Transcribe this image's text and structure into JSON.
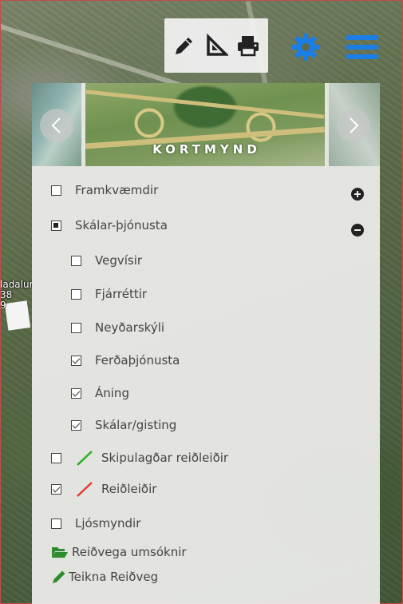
{
  "map": {
    "place_label_lines": [
      "ladalur",
      "38",
      "9"
    ]
  },
  "toolbar": {
    "icons": [
      "pencil-icon",
      "ruler-triangle-icon",
      "printer-icon"
    ],
    "settings_icon": "gear-icon",
    "menu_icon": "hamburger-icon",
    "accent_color": "#1a7ee6"
  },
  "panel": {
    "carousel": {
      "title": "KORTMYND",
      "prev_icon": "chevron-left-icon",
      "next_icon": "chevron-right-icon"
    },
    "layers": [
      {
        "label": "Framkvæmdir",
        "state": "unchecked"
      },
      {
        "label": "Skálar-þjónusta",
        "state": "partial"
      },
      {
        "label": "Vegvísir",
        "state": "unchecked"
      },
      {
        "label": "Fjárréttir",
        "state": "unchecked"
      },
      {
        "label": "Neyðarskýli",
        "state": "unchecked"
      },
      {
        "label": "Ferðaþjónusta",
        "state": "checked"
      },
      {
        "label": "Áning",
        "state": "checked"
      },
      {
        "label": "Skálar/gisting",
        "state": "checked"
      },
      {
        "label": "Skipulagðar reiðleiðir",
        "state": "unchecked",
        "line_color": "#22b022"
      },
      {
        "label": "Reiðleiðir",
        "state": "checked",
        "line_color": "#e53935"
      },
      {
        "label": "Ljósmyndir",
        "state": "unchecked"
      }
    ],
    "actions": [
      {
        "label": "Reiðvega umsóknir",
        "icon": "folder-open-icon",
        "color": "#2e8b2e"
      },
      {
        "label": "Teikna Reiðveg",
        "icon": "pencil-icon",
        "color": "#2e8b2e"
      }
    ],
    "expand_icon": "plus-circle-icon",
    "collapse_icon": "minus-circle-icon"
  }
}
